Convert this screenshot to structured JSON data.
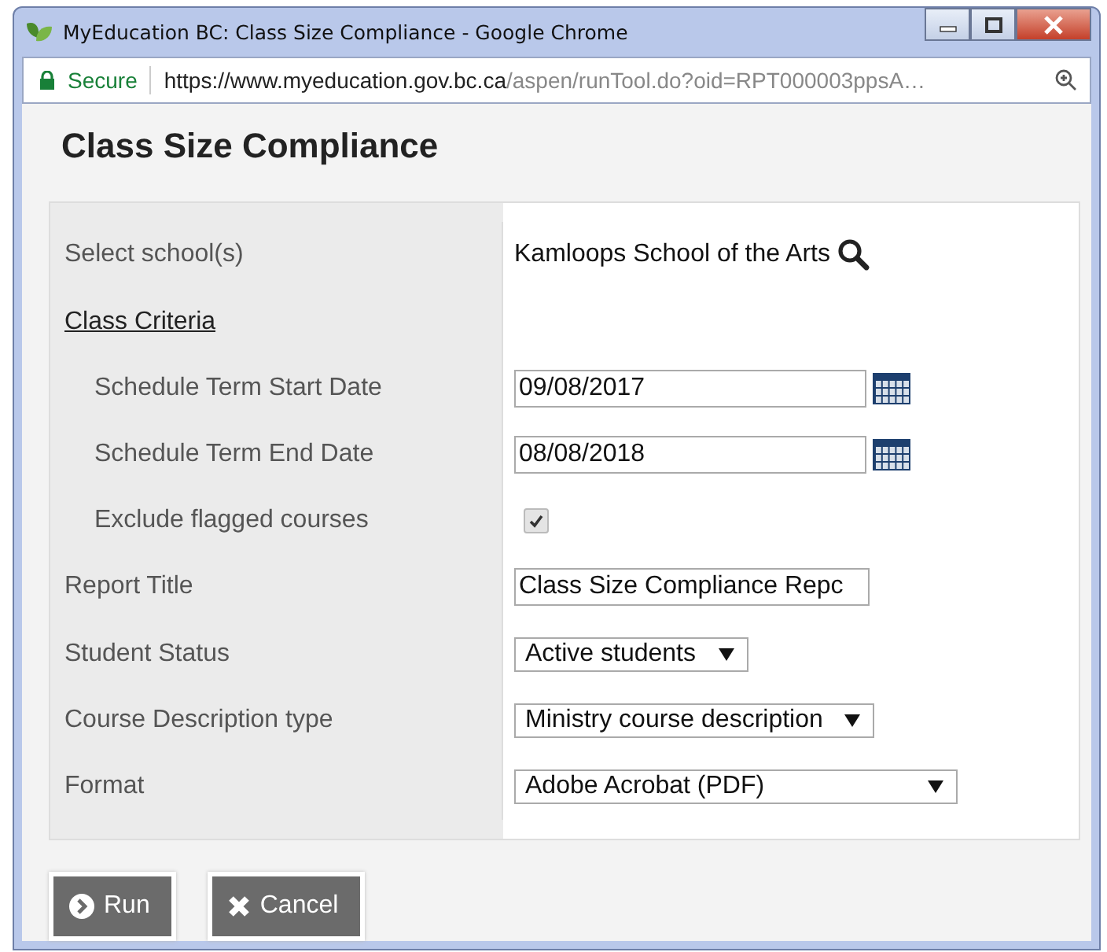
{
  "window": {
    "title": "MyEducation BC: Class Size Compliance - Google Chrome"
  },
  "address_bar": {
    "security": "Secure",
    "host": "https://www.myeducation.gov.bc.ca",
    "path": "/aspen/runTool.do?oid=RPT000003ppsA…"
  },
  "page_title": "Class Size Compliance",
  "rows": [
    {
      "kind": "lookup",
      "label": "Select school(s)",
      "value": "Kamloops School of the Arts"
    },
    {
      "kind": "section",
      "label": "Class Criteria",
      "children": [
        {
          "kind": "date",
          "label": "Schedule Term Start Date",
          "value": "09/08/2017"
        },
        {
          "kind": "date",
          "label": "Schedule Term End Date",
          "value": "08/08/2018"
        },
        {
          "kind": "checkbox",
          "label": "Exclude flagged courses",
          "checked": true
        }
      ]
    },
    {
      "kind": "text",
      "label": "Report Title",
      "value": "Class Size Compliance Repc"
    },
    {
      "kind": "select",
      "label": "Student Status",
      "value": "Active students"
    },
    {
      "kind": "select",
      "label": "Course Description type",
      "value": "Ministry course description"
    },
    {
      "kind": "select",
      "label": "Format",
      "value": "Adobe Acrobat (PDF)"
    }
  ],
  "buttons": [
    {
      "kind": "run",
      "label": "Run"
    },
    {
      "kind": "cancel",
      "label": "Cancel"
    }
  ]
}
